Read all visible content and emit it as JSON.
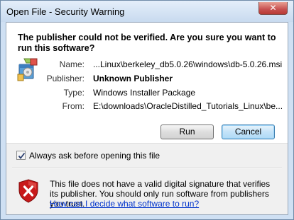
{
  "window": {
    "title": "Open File - Security Warning",
    "close_glyph": "✕"
  },
  "heading": "The publisher could not be verified.  Are you sure you want to run this software?",
  "file_icon": "installer-package-icon",
  "details": {
    "name_label": "Name:",
    "name_value": "...Linux\\berkeley_db5.0.26\\windows\\db-5.0.26.msi",
    "publisher_label": "Publisher:",
    "publisher_value": "Unknown Publisher",
    "type_label": "Type:",
    "type_value": "Windows Installer Package",
    "from_label": "From:",
    "from_value": "E:\\downloads\\OracleDistilled_Tutorials_Linux\\be..."
  },
  "buttons": {
    "run": "Run",
    "cancel": "Cancel"
  },
  "checkbox": {
    "label": "Always ask before opening this file",
    "checked": true
  },
  "warning": {
    "icon": "shield-warning-icon",
    "text": "This file does not have a valid digital signature that verifies its publisher.  You should only run software from publishers you trust.",
    "link": "How can I decide what software to run?"
  },
  "colors": {
    "link": "#0033cc",
    "shield_red": "#c8191a"
  }
}
